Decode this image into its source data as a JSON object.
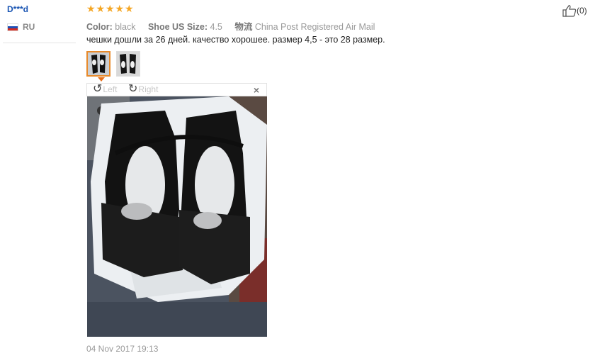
{
  "review": {
    "username": "D***d",
    "country_code": "RU",
    "country_flag_colors": [
      "#ffffff",
      "#1f4fb5",
      "#d52b1e"
    ],
    "rating_stars": 5,
    "attributes": [
      {
        "label": "Color:",
        "value": "black"
      },
      {
        "label": "Shoe US Size:",
        "value": "4.5"
      },
      {
        "label": "物流",
        "value": "China Post Registered Air Mail"
      }
    ],
    "text": "чешки дошли за 26 дней. качество хорошее. размер 4,5 - это 28 размер.",
    "thumbnails": [
      {
        "name": "photo-1",
        "active": true
      },
      {
        "name": "photo-2",
        "active": false
      }
    ],
    "viewer": {
      "rotate_left_label": "Left",
      "rotate_right_label": "Right",
      "close_symbol": "×"
    },
    "date": "04 Nov 2017 19:13",
    "helpful": {
      "icon": "thumbs-up-icon",
      "count_text": "(0)"
    }
  },
  "colors": {
    "username": "#1a55b3",
    "star": "#f5a623",
    "active_thumb_border": "#e88a2b"
  }
}
